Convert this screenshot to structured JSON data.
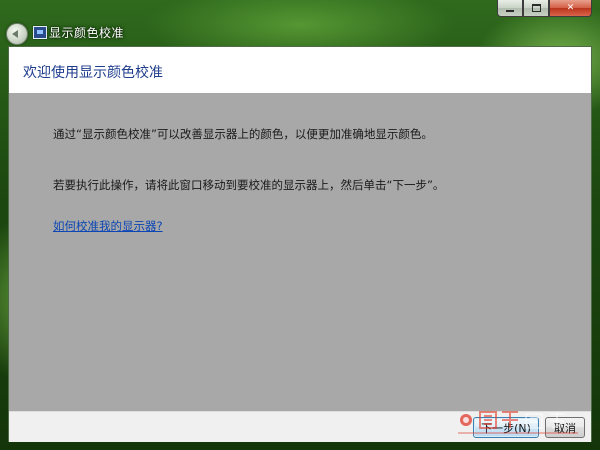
{
  "window": {
    "title": "显示颜色校准"
  },
  "header": {
    "heading": "欢迎使用显示颜色校准"
  },
  "body": {
    "paragraph1": "通过“显示颜色校准”可以改善显示器上的颜色，以便更加准确地显示颜色。",
    "paragraph2": "若要执行此操作，请将此窗口移动到要校准的显示器上，然后单击“下一步”。",
    "help_link": "如何校准我的显示器?"
  },
  "footer": {
    "next_label": "下一步(N)",
    "cancel_label": "取消"
  },
  "colors": {
    "heading": "#1e3c8c",
    "link": "#0b46b4",
    "content_background": "#a8a8a8"
  }
}
